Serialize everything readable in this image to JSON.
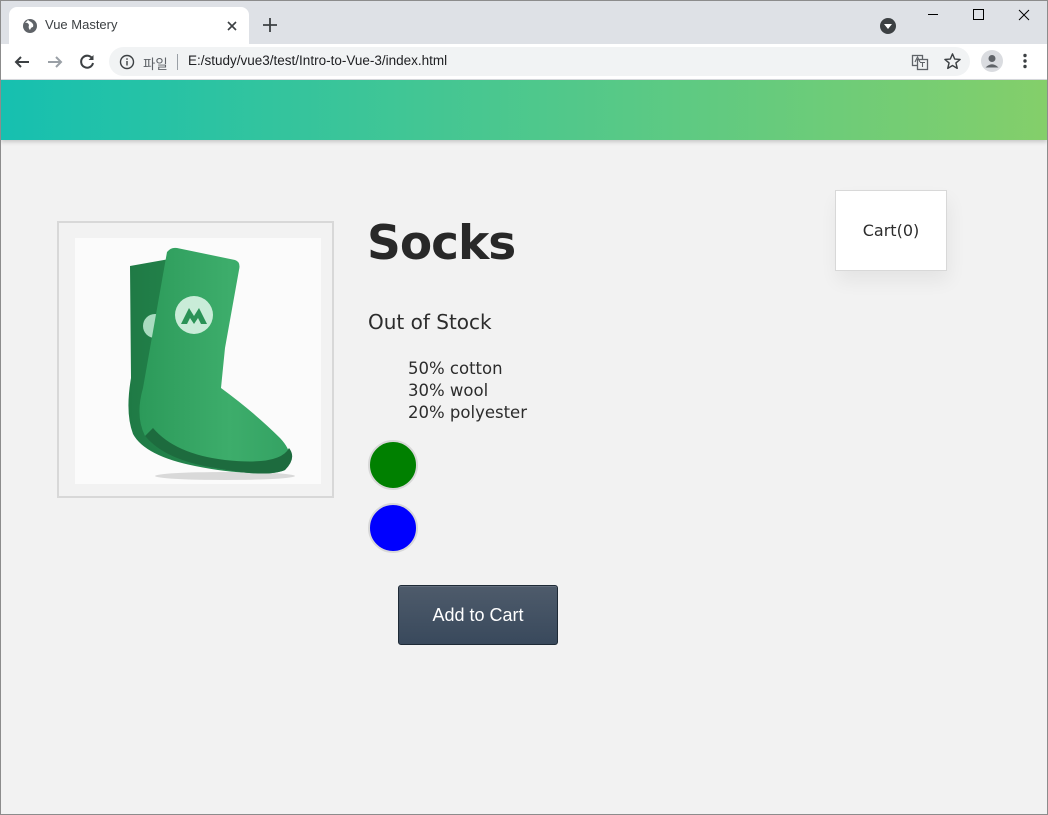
{
  "browser": {
    "tab_title": "Vue Mastery",
    "url_label": "파일",
    "url": "E:/study/vue3/test/Intro-to-Vue-3/index.html"
  },
  "page": {
    "nav_gradient": [
      "#16c0b0",
      "#84cf6a"
    ],
    "cart_label": "Cart(0)",
    "product": {
      "title": "Socks",
      "stock_status": "Out of Stock",
      "details": [
        "50% cotton",
        "30% wool",
        "20% polyester"
      ],
      "variants": [
        {
          "color": "green"
        },
        {
          "color": "blue"
        }
      ],
      "add_to_cart_label": "Add to Cart"
    }
  }
}
